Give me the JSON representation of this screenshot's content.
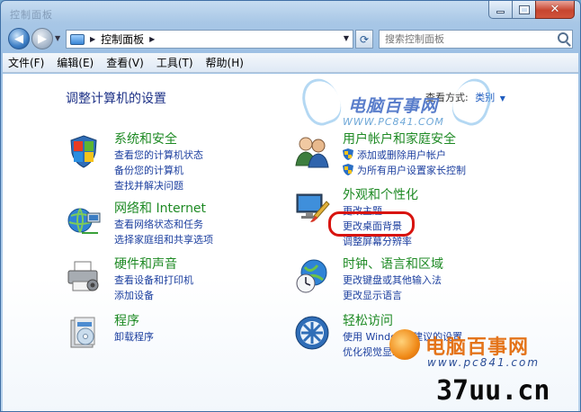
{
  "window": {
    "title": "控制面板"
  },
  "address_bar": {
    "crumb": "控制面板",
    "search_placeholder": "搜索控制面板"
  },
  "menu": [
    "文件(F)",
    "编辑(E)",
    "查看(V)",
    "工具(T)",
    "帮助(H)"
  ],
  "page": {
    "title": "调整计算机的设置",
    "view_by_label": "查看方式:",
    "view_by_value": "类别"
  },
  "categories": [
    {
      "title": "系统和安全",
      "icon": "shield-flag-icon",
      "links": [
        "查看您的计算机状态",
        "备份您的计算机",
        "查找并解决问题"
      ]
    },
    {
      "title": "网络和 Internet",
      "icon": "network-globe-icon",
      "links": [
        "查看网络状态和任务",
        "选择家庭组和共享选项"
      ]
    },
    {
      "title": "硬件和声音",
      "icon": "printer-icon",
      "links": [
        "查看设备和打印机",
        "添加设备"
      ]
    },
    {
      "title": "程序",
      "icon": "programs-box-icon",
      "links": [
        "卸载程序"
      ]
    },
    {
      "title": "用户帐户和家庭安全",
      "icon": "users-icon",
      "links": [
        "添加或删除用户帐户",
        "为所有用户设置家长控制"
      ]
    },
    {
      "title": "外观和个性化",
      "icon": "monitor-brush-icon",
      "links": [
        "更改主题",
        "更改桌面背景",
        "调整屏幕分辨率"
      ]
    },
    {
      "title": "时钟、语言和区域",
      "icon": "clock-globe-icon",
      "links": [
        "更改键盘或其他输入法",
        "更改显示语言"
      ]
    },
    {
      "title": "轻松访问",
      "icon": "accessibility-icon",
      "links": [
        "使用 Windows 建议的设置",
        "优化视觉显示"
      ]
    }
  ],
  "watermarks": {
    "top_brand": "电脑百事网",
    "top_url": "WWW.PC841.COM",
    "bottom_brand": "电脑百事网",
    "bottom_url": "www.pc841.com",
    "site": "37uu.cn"
  },
  "colors": {
    "category_title": "#1e8a24",
    "link": "#1c3f9f",
    "highlight_border": "#d8140f"
  }
}
